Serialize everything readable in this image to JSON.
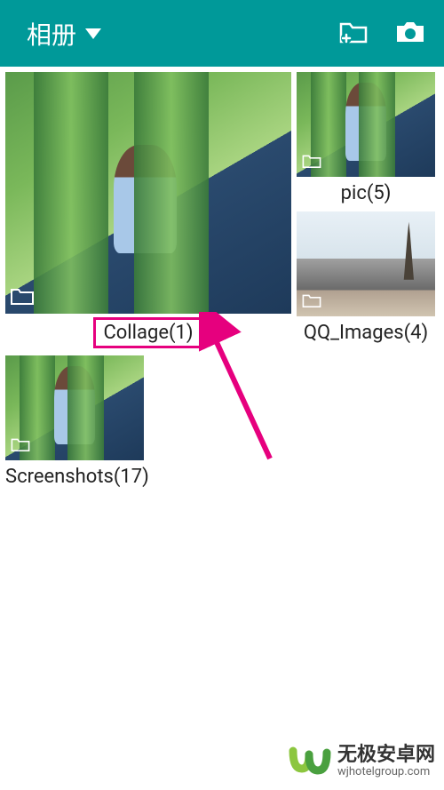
{
  "header": {
    "title": "相册",
    "actions": {
      "add_folder": "add-folder",
      "camera": "camera"
    }
  },
  "albums": {
    "collage": {
      "label": "Collage(1)"
    },
    "pic": {
      "label": "pic(5)"
    },
    "qq_images": {
      "label": "QQ_Images(4)"
    },
    "screenshots": {
      "label": "Screenshots(17)"
    }
  },
  "watermark": {
    "title": "无极安卓网",
    "url": "wjhotelgroup.com"
  },
  "colors": {
    "accent": "#e6007e",
    "header": "#009999"
  }
}
